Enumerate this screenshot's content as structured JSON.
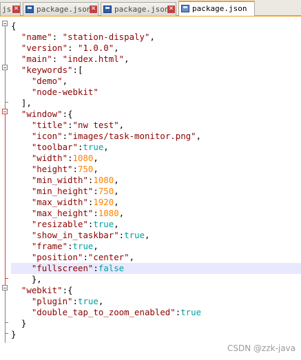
{
  "tabs": [
    {
      "label": "js",
      "active": false,
      "has_icon": false
    },
    {
      "label": "package.json",
      "active": false,
      "has_icon": true
    },
    {
      "label": "package.json",
      "active": false,
      "has_icon": true
    },
    {
      "label": "package.json",
      "active": true,
      "has_icon": true
    }
  ],
  "code_lines": [
    [
      [
        "p",
        "{"
      ]
    ],
    [
      [
        "p",
        "  "
      ],
      [
        "k",
        "\"name\""
      ],
      [
        "p",
        ": "
      ],
      [
        "s",
        "\"station-dispaly\""
      ],
      [
        "p",
        ","
      ]
    ],
    [
      [
        "p",
        "  "
      ],
      [
        "k",
        "\"version\""
      ],
      [
        "p",
        ": "
      ],
      [
        "s",
        "\"1.0.0\""
      ],
      [
        "p",
        ","
      ]
    ],
    [
      [
        "p",
        "  "
      ],
      [
        "k",
        "\"main\""
      ],
      [
        "p",
        ": "
      ],
      [
        "s",
        "\"index.html\""
      ],
      [
        "p",
        ","
      ]
    ],
    [
      [
        "p",
        "  "
      ],
      [
        "k",
        "\"keywords\""
      ],
      [
        "p",
        ":["
      ]
    ],
    [
      [
        "p",
        "    "
      ],
      [
        "s",
        "\"demo\""
      ],
      [
        "p",
        ","
      ]
    ],
    [
      [
        "p",
        "    "
      ],
      [
        "s",
        "\"node-webkit\""
      ]
    ],
    [
      [
        "p",
        "  ],"
      ]
    ],
    [
      [
        "p",
        "  "
      ],
      [
        "k",
        "\"window\""
      ],
      [
        "p",
        ":{"
      ]
    ],
    [
      [
        "p",
        "    "
      ],
      [
        "k",
        "\"title\""
      ],
      [
        "p",
        ":"
      ],
      [
        "s",
        "\"nw test\""
      ],
      [
        "p",
        ","
      ]
    ],
    [
      [
        "p",
        "    "
      ],
      [
        "k",
        "\"icon\""
      ],
      [
        "p",
        ":"
      ],
      [
        "s",
        "\"images/task-monitor.png\""
      ],
      [
        "p",
        ","
      ]
    ],
    [
      [
        "p",
        "    "
      ],
      [
        "k",
        "\"toolbar\""
      ],
      [
        "p",
        ":"
      ],
      [
        "b",
        "true"
      ],
      [
        "p",
        ","
      ]
    ],
    [
      [
        "p",
        "    "
      ],
      [
        "k",
        "\"width\""
      ],
      [
        "p",
        ":"
      ],
      [
        "n",
        "1080"
      ],
      [
        "p",
        ","
      ]
    ],
    [
      [
        "p",
        "    "
      ],
      [
        "k",
        "\"height\""
      ],
      [
        "p",
        ":"
      ],
      [
        "n",
        "750"
      ],
      [
        "p",
        ","
      ]
    ],
    [
      [
        "p",
        "    "
      ],
      [
        "k",
        "\"min_width\""
      ],
      [
        "p",
        ":"
      ],
      [
        "n",
        "1080"
      ],
      [
        "p",
        ","
      ]
    ],
    [
      [
        "p",
        "    "
      ],
      [
        "k",
        "\"min_height\""
      ],
      [
        "p",
        ":"
      ],
      [
        "n",
        "750"
      ],
      [
        "p",
        ","
      ]
    ],
    [
      [
        "p",
        "    "
      ],
      [
        "k",
        "\"max_width\""
      ],
      [
        "p",
        ":"
      ],
      [
        "n",
        "1920"
      ],
      [
        "p",
        ","
      ]
    ],
    [
      [
        "p",
        "    "
      ],
      [
        "k",
        "\"max_height\""
      ],
      [
        "p",
        ":"
      ],
      [
        "n",
        "1080"
      ],
      [
        "p",
        ","
      ]
    ],
    [
      [
        "p",
        "    "
      ],
      [
        "k",
        "\"resizable\""
      ],
      [
        "p",
        ":"
      ],
      [
        "b",
        "true"
      ],
      [
        "p",
        ","
      ]
    ],
    [
      [
        "p",
        "    "
      ],
      [
        "k",
        "\"show_in_taskbar\""
      ],
      [
        "p",
        ":"
      ],
      [
        "b",
        "true"
      ],
      [
        "p",
        ","
      ]
    ],
    [
      [
        "p",
        "    "
      ],
      [
        "k",
        "\"frame\""
      ],
      [
        "p",
        ":"
      ],
      [
        "b",
        "true"
      ],
      [
        "p",
        ","
      ]
    ],
    [
      [
        "p",
        "    "
      ],
      [
        "k",
        "\"position\""
      ],
      [
        "p",
        ":"
      ],
      [
        "s",
        "\"center\""
      ],
      [
        "p",
        ","
      ]
    ],
    [
      [
        "p",
        "    "
      ],
      [
        "k",
        "\"fullscreen\""
      ],
      [
        "p",
        ":"
      ],
      [
        "b",
        "false"
      ]
    ],
    [
      [
        "p",
        "    },"
      ]
    ],
    [
      [
        "p",
        "  "
      ],
      [
        "k",
        "\"webkit\""
      ],
      [
        "p",
        ":{"
      ]
    ],
    [
      [
        "p",
        "    "
      ],
      [
        "k",
        "\"plugin\""
      ],
      [
        "p",
        ":"
      ],
      [
        "b",
        "true"
      ],
      [
        "p",
        ","
      ]
    ],
    [
      [
        "p",
        "    "
      ],
      [
        "k",
        "\"double_tap_to_zoom_enabled\""
      ],
      [
        "p",
        ":"
      ],
      [
        "b",
        "true"
      ]
    ],
    [
      [
        "p",
        "  }"
      ]
    ],
    [
      [
        "p",
        "}"
      ]
    ]
  ],
  "highlighted_line": 22,
  "watermark": "CSDN @zzk-java",
  "colors": {
    "key": "#8b0000",
    "string": "#8b0000",
    "number": "#ff8000",
    "boolean": "#00a0a0",
    "active_tab_accent": "#f0a030",
    "line_highlight": "#e8e8ff"
  }
}
